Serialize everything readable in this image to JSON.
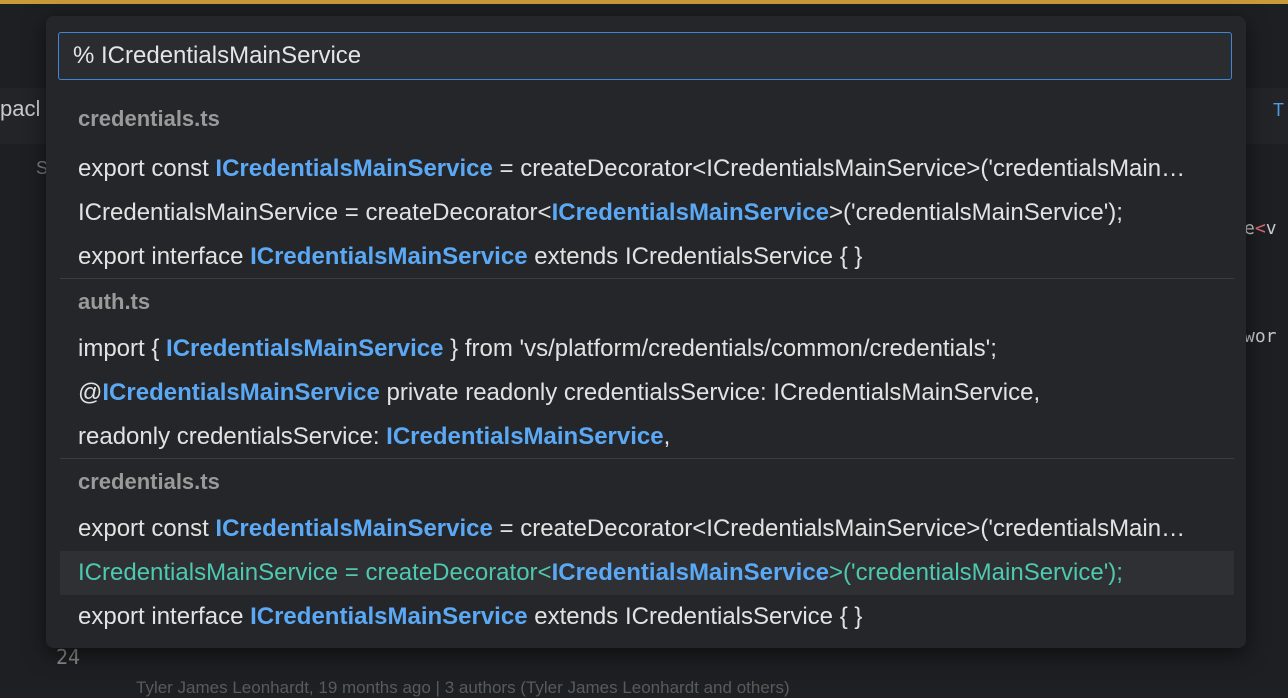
{
  "background": {
    "tab_fragment": "pacl",
    "tab_right_fragment": "T",
    "section_fragment": "S",
    "code_right_1_pre": "e",
    "code_right_1_lt": "<",
    "code_right_1_post": "v",
    "code_right_2": "wor",
    "line_number": "24",
    "blame": "Tyler James Leonhardt, 19 months ago | 3 authors (Tyler James Leonhardt and others)"
  },
  "search": {
    "value": "% ICredentialsMainService"
  },
  "groups": [
    {
      "file": "credentials.ts",
      "results": [
        {
          "pre": "export const ",
          "match": "ICredentialsMainService",
          "post": " = createDecorator<ICredentialsMainService>('credentialsMainService');"
        },
        {
          "pre": "ICredentialsMainService = createDecorator<",
          "match": "ICredentialsMainService",
          "post": ">('credentialsMainService');"
        },
        {
          "pre": "export interface ",
          "match": "ICredentialsMainService",
          "post": " extends ICredentialsService { }"
        }
      ]
    },
    {
      "file": "auth.ts",
      "results": [
        {
          "pre": "import { ",
          "match": "ICredentialsMainService",
          "post": " } from 'vs/platform/credentials/common/credentials';"
        },
        {
          "pre": "@",
          "match": "ICredentialsMainService",
          "post": " private readonly credentialsService: ICredentialsMainService,"
        },
        {
          "pre": "readonly credentialsService: ",
          "match": "ICredentialsMainService",
          "post": ","
        }
      ]
    },
    {
      "file": "credentials.ts",
      "results": [
        {
          "pre": "export const ",
          "match": "ICredentialsMainService",
          "post": " = createDecorator<ICredentialsMainService>('credentialsMainService');"
        },
        {
          "pre": "ICredentialsMainService = createDecorator<",
          "match": "ICredentialsMainService",
          "post": ">('credentialsMainService');"
        },
        {
          "pre": "export interface ",
          "match": "ICredentialsMainService",
          "post": " extends ICredentialsService { }"
        }
      ]
    }
  ],
  "colors": {
    "match_highlight": "#5ba8f5",
    "selected_row_text": "#4ec9b0",
    "input_border": "#3f86d6",
    "top_accent": "#c99a3a"
  }
}
